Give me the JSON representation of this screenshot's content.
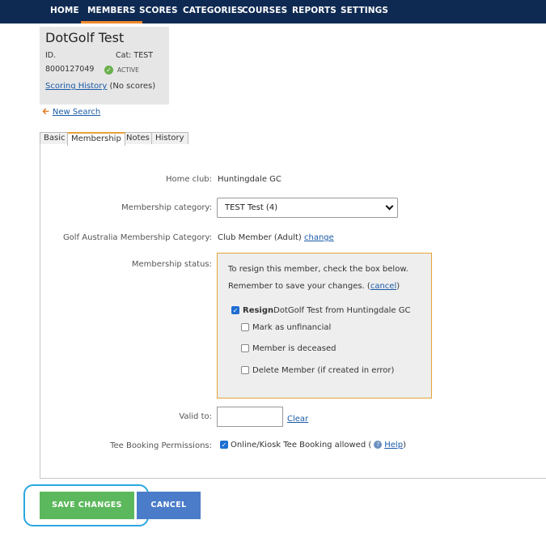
{
  "nav": {
    "items": [
      "HOME",
      "MEMBERS",
      "SCORES",
      "CATEGORIES",
      "COURSES",
      "REPORTS",
      "SETTINGS"
    ],
    "active": "MEMBERS",
    "accent": "#f0882a",
    "bg": "#0f2a52"
  },
  "member": {
    "name": "DotGolf Test",
    "id_label": "ID.",
    "id_value": "8000127049",
    "cat": "Cat: TEST",
    "status": "ACTIVE",
    "scoring_history_link": "Scoring History",
    "scoring_history_note": "(No scores)"
  },
  "new_search": "New Search",
  "tabs": [
    "Basic",
    "Membership",
    "Notes",
    "History"
  ],
  "form": {
    "home_club_label": "Home club:",
    "home_club_value": "Huntingdale GC",
    "membership_category_label": "Membership category:",
    "membership_category_value": "TEST Test (4)",
    "ga_category_label": "Golf Australia Membership Category:",
    "ga_category_value": "Club Member (Adult)",
    "ga_change_link": "change",
    "status_label": "Membership status:",
    "resign_box": {
      "line1": "To resign this member, check the box below.",
      "line2_prefix": "Remember to save your changes. (",
      "cancel_link": "cancel",
      "line2_suffix": ")",
      "resign_bold": "Resign",
      "resign_rest": " DotGolf Test from Huntingdale GC",
      "resign_checked": true,
      "opt_unfinancial": "Mark as unfinancial",
      "opt_deceased": "Member is deceased",
      "opt_delete": "Delete Member (if created in error)"
    },
    "valid_to_label": "Valid to:",
    "valid_to_value": "",
    "clear_link": "Clear",
    "tee_label": "Tee Booking Permissions:",
    "tee_text_prefix": "Online/Kiosk Tee Booking allowed (",
    "help_link": "Help",
    "tee_text_suffix": ")",
    "tee_checked": true
  },
  "buttons": {
    "save": "SAVE CHANGES",
    "cancel": "CANCEL"
  }
}
